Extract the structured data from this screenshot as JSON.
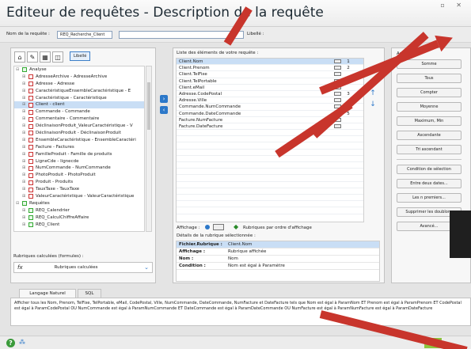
{
  "window": {
    "title": "Editeur de requêtes - Description de la requête",
    "controls": "▫ ✕"
  },
  "namebar": {
    "label": "Nom de la requête :",
    "value": "REQ_Recherche_Client",
    "label2": "Libellé :"
  },
  "left_panel": {
    "toolbar_label": "Libellé",
    "tree": [
      {
        "pm": "⊟",
        "icon": "req",
        "text": "Analyse",
        "indent": 0
      },
      {
        "pm": "⊞",
        "icon": "tbl",
        "text": "AdresseArchive - AdresseArchive",
        "indent": 1
      },
      {
        "pm": "⊞",
        "icon": "tbl",
        "text": "Adresse - Adresse",
        "indent": 1
      },
      {
        "pm": "⊞",
        "icon": "tbl",
        "text": "CaractéristiqueEnsembleCaractéristique - E",
        "indent": 1
      },
      {
        "pm": "⊞",
        "icon": "tbl",
        "text": "Caractéristique - Caractéristique",
        "indent": 1
      },
      {
        "pm": "⊞",
        "icon": "tbl",
        "text": "Client - client",
        "indent": 1,
        "selected": true
      },
      {
        "pm": "⊞",
        "icon": "tbl",
        "text": "Commande - Commande",
        "indent": 1
      },
      {
        "pm": "⊞",
        "icon": "tbl",
        "text": "Commentaire - Commentaire",
        "indent": 1
      },
      {
        "pm": "⊞",
        "icon": "tbl",
        "text": "DéclinaisonProduit_ValeurCaractéristique - V",
        "indent": 1
      },
      {
        "pm": "⊞",
        "icon": "tbl",
        "text": "DéclinaisonProduit - DéclinaisonProduit",
        "indent": 1
      },
      {
        "pm": "⊞",
        "icon": "tbl",
        "text": "EnsembleCaractéristique - EnsembleCaractéri",
        "indent": 1
      },
      {
        "pm": "⊞",
        "icon": "tbl",
        "text": "Facture - Factures",
        "indent": 1
      },
      {
        "pm": "⊞",
        "icon": "tbl",
        "text": "FamilleProduit - Famille de produits",
        "indent": 1
      },
      {
        "pm": "⊞",
        "icon": "tbl",
        "text": "LigneCde - lignecde",
        "indent": 1
      },
      {
        "pm": "⊞",
        "icon": "tbl",
        "text": "NumCommande - NumCommande",
        "indent": 1
      },
      {
        "pm": "⊞",
        "icon": "tbl",
        "text": "PhotoProduit - PhotoProduit",
        "indent": 1
      },
      {
        "pm": "⊞",
        "icon": "tbl",
        "text": "Produit - Produits",
        "indent": 1
      },
      {
        "pm": "⊞",
        "icon": "tbl",
        "text": "TauxTaxe - TauxTaxe",
        "indent": 1
      },
      {
        "pm": "⊞",
        "icon": "tbl",
        "text": "ValeurCaractéristique - ValeurCaractéristique",
        "indent": 1
      },
      {
        "pm": "⊟",
        "icon": "req",
        "text": "Requêtes",
        "indent": 0
      },
      {
        "pm": "⊞",
        "icon": "req",
        "text": "REQ_Calendrier",
        "indent": 1
      },
      {
        "pm": "⊞",
        "icon": "req",
        "text": "REQ_CalculChiffreAffaire",
        "indent": 1
      },
      {
        "pm": "⊞",
        "icon": "req",
        "text": "REQ_Client",
        "indent": 1
      }
    ],
    "calc_label": "Rubriques calculées (formules) :",
    "calc_value": "Rubriques calculées"
  },
  "center_panel": {
    "header": "Liste des éléments de votre requête :",
    "rows": [
      {
        "text": "Client.Nom",
        "num": "1",
        "selected": true
      },
      {
        "text": "Client.Prenom",
        "num": "2"
      },
      {
        "text": "Client.TelFixe",
        "num": ""
      },
      {
        "text": "Client.TelPortable",
        "num": ""
      },
      {
        "text": "Client.eMail",
        "num": ""
      },
      {
        "text": "Adresse.CodePostal",
        "num": "3"
      },
      {
        "text": "Adresse.Ville",
        "num": ""
      },
      {
        "text": "Commande.NumCommande",
        "num": "4"
      },
      {
        "text": "Commande.DateCommande",
        "num": "5"
      },
      {
        "text": "Facture.NumFacture",
        "num": ""
      },
      {
        "text": "Facture.DateFacture",
        "num": ""
      }
    ],
    "affichage_label": "Affichage :",
    "affichage_value": "Rubriques par ordre d'affichage",
    "details_header": "Détails de la rubrique sélectionnée :",
    "details": [
      {
        "k": "Fichier.Rubrique :",
        "v": "Client.Nom"
      },
      {
        "k": "Affichage :",
        "v": "Rubrique affichée"
      },
      {
        "k": "Nom :",
        "v": "Nom"
      },
      {
        "k": "Condition :",
        "v": "Nom  est égal à Paramètre"
      }
    ]
  },
  "right_panel": {
    "header": "Actions",
    "buttons": [
      "Somme",
      "Tous",
      "Compter",
      "Moyenne",
      "Maximum, Min",
      "Ascendante",
      "Tri ascendant",
      "Condition de sélection",
      "Entre deux dates...",
      "Les n premiers...",
      "Supprimer les doublons",
      "Avancé..."
    ]
  },
  "bottom": {
    "tab_label": "Langage Naturel",
    "tab_sql": "SQL",
    "text": "Afficher tous les Nom, Prenom, TelFixe, TelPortable, eMail, CodePostal, Ville, NumCommande, DateCommande, NumFacture et DateFacture tels que Nom est égal à ParamNom ET Prenom est égal à ParamPrenom ET CodePostal est égal à ParamCodePostal OU NumCommande est égal à ParamNumCommande ET DateCommande est égal à ParamDateCommande OU NumFacture est égal à ParamNumFacture est égal à ParamDateFacture"
  },
  "statusbar": {
    "help_icon": "?",
    "ok_label": "✓"
  },
  "colors": {
    "accent": "#2c78c9",
    "arrow": "#c8352c",
    "selection": "#c9def5"
  }
}
